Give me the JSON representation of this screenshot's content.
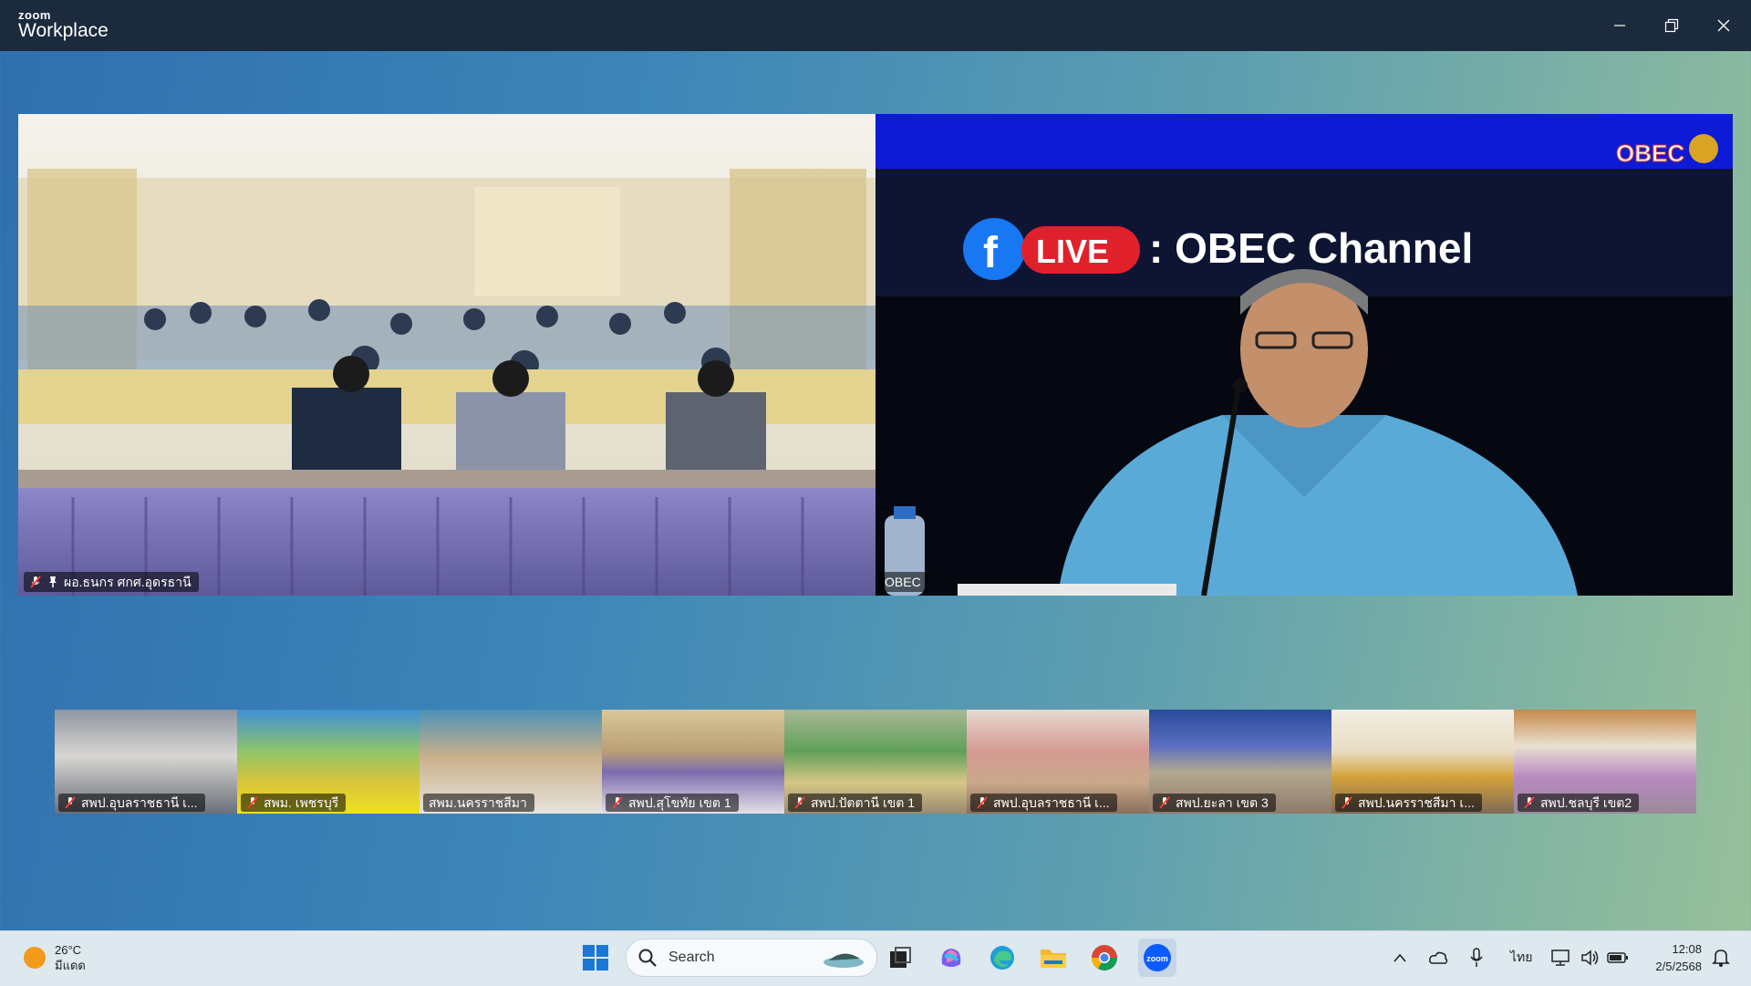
{
  "app": {
    "brand_top": "zoom",
    "brand_bottom": "Workplace"
  },
  "main_tiles": [
    {
      "name": "ผอ.ธนกร ศกศ.อุดรธานี",
      "muted": true,
      "pinned": true
    },
    {
      "name": "OBEC",
      "muted": false,
      "pinned": false,
      "overlay": {
        "live_text": "LIVE",
        "channel_text": ": OBEC Channel",
        "logo_text": "OBEC"
      }
    }
  ],
  "thumbnails": [
    {
      "name": "สพป.อุบลราชธานี เ..."
    },
    {
      "name": "สพม. เพชรบุรี"
    },
    {
      "name": "สพม.นครราชสีมา"
    },
    {
      "name": "สพป.สุโขทัย เขต 1"
    },
    {
      "name": "สพป.ปัตตานี เขต 1"
    },
    {
      "name": "สพป.อุบลราชธานี เ..."
    },
    {
      "name": "สพป.ยะลา เขต 3"
    },
    {
      "name": "สพป.นครราชสีมา เ..."
    },
    {
      "name": "สพป.ชลบุรี เขต2"
    }
  ],
  "taskbar": {
    "weather": {
      "temp": "26°C",
      "condition": "มีแดด"
    },
    "search_placeholder": "Search",
    "language": "ไทย",
    "time": "12:08",
    "date": "2/5/2568"
  },
  "colors": {
    "active_speaker_border": "#2ee88a",
    "titlebar": "#1b2a3c"
  }
}
